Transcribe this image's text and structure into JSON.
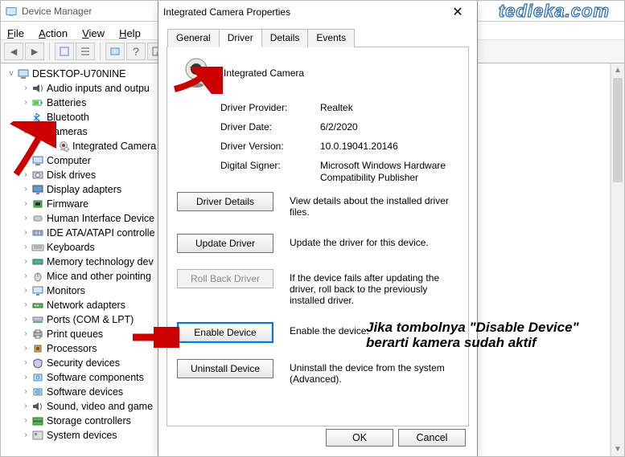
{
  "window": {
    "title": "Device Manager"
  },
  "watermark": "tedieka.com",
  "menu": {
    "file": "File",
    "action": "Action",
    "view": "View",
    "help": "Help"
  },
  "toolbar_icons": [
    "back",
    "forward",
    "up",
    "|",
    "list",
    "props",
    "refresh",
    "enable",
    "scan",
    "disable"
  ],
  "tree": {
    "root": {
      "label": "DESKTOP-U70NINE",
      "expanded": true
    },
    "items": [
      {
        "tw": ">",
        "icon": "audio",
        "label": "Audio inputs and outpu"
      },
      {
        "tw": ">",
        "icon": "battery",
        "label": "Batteries"
      },
      {
        "tw": "",
        "icon": "bluetooth",
        "label": "Bluetooth"
      },
      {
        "tw": "v",
        "icon": "camera",
        "label": "Cameras"
      },
      {
        "indent": true,
        "icon": "camera-dev",
        "label": "Integrated Camera"
      },
      {
        "tw": ">",
        "icon": "pc",
        "label": "Computer"
      },
      {
        "tw": ">",
        "icon": "disk",
        "label": "Disk drives"
      },
      {
        "tw": ">",
        "icon": "display",
        "label": "Display adapters"
      },
      {
        "tw": ">",
        "icon": "firmware",
        "label": "Firmware"
      },
      {
        "tw": ">",
        "icon": "hid",
        "label": "Human Interface Device"
      },
      {
        "tw": ">",
        "icon": "ide",
        "label": "IDE ATA/ATAPI controlle"
      },
      {
        "tw": ">",
        "icon": "keyboard",
        "label": "Keyboards"
      },
      {
        "tw": ">",
        "icon": "memory",
        "label": "Memory technology dev"
      },
      {
        "tw": ">",
        "icon": "mouse",
        "label": "Mice and other pointing"
      },
      {
        "tw": ">",
        "icon": "monitor",
        "label": "Monitors"
      },
      {
        "tw": ">",
        "icon": "network",
        "label": "Network adapters"
      },
      {
        "tw": ">",
        "icon": "ports",
        "label": "Ports (COM & LPT)"
      },
      {
        "tw": ">",
        "icon": "print",
        "label": "Print queues"
      },
      {
        "tw": ">",
        "icon": "cpu",
        "label": "Processors"
      },
      {
        "tw": ">",
        "icon": "security",
        "label": "Security devices"
      },
      {
        "tw": ">",
        "icon": "softcomp",
        "label": "Software components"
      },
      {
        "tw": ">",
        "icon": "softdev",
        "label": "Software devices"
      },
      {
        "tw": ">",
        "icon": "sound",
        "label": "Sound, video and game"
      },
      {
        "tw": ">",
        "icon": "storage",
        "label": "Storage controllers"
      },
      {
        "tw": ">",
        "icon": "system",
        "label": "System devices"
      }
    ]
  },
  "dialog": {
    "title": "Integrated Camera Properties",
    "close": "✕",
    "tabs": {
      "general": "General",
      "driver": "Driver",
      "details": "Details",
      "events": "Events"
    },
    "device_name": "Integrated Camera",
    "info": {
      "provider_label": "Driver Provider:",
      "provider": "Realtek",
      "date_label": "Driver Date:",
      "date": "6/2/2020",
      "version_label": "Driver Version:",
      "version": "10.0.19041.20146",
      "signer_label": "Digital Signer:",
      "signer": "Microsoft Windows Hardware Compatibility Publisher"
    },
    "actions": {
      "details": {
        "btn": "Driver Details",
        "desc": "View details about the installed driver files."
      },
      "update": {
        "btn": "Update Driver",
        "desc": "Update the driver for this device."
      },
      "rollback": {
        "btn": "Roll Back Driver",
        "desc": "If the device fails after updating the driver, roll back to the previously installed driver."
      },
      "enable": {
        "btn": "Enable Device",
        "desc": "Enable the device."
      },
      "uninstall": {
        "btn": "Uninstall Device",
        "desc": "Uninstall the device from the system (Advanced)."
      }
    },
    "footer": {
      "ok": "OK",
      "cancel": "Cancel"
    }
  },
  "annotations": {
    "line1": "Jika tombolnya \"Disable Device\"",
    "line2": "berarti kamera sudah aktif"
  }
}
